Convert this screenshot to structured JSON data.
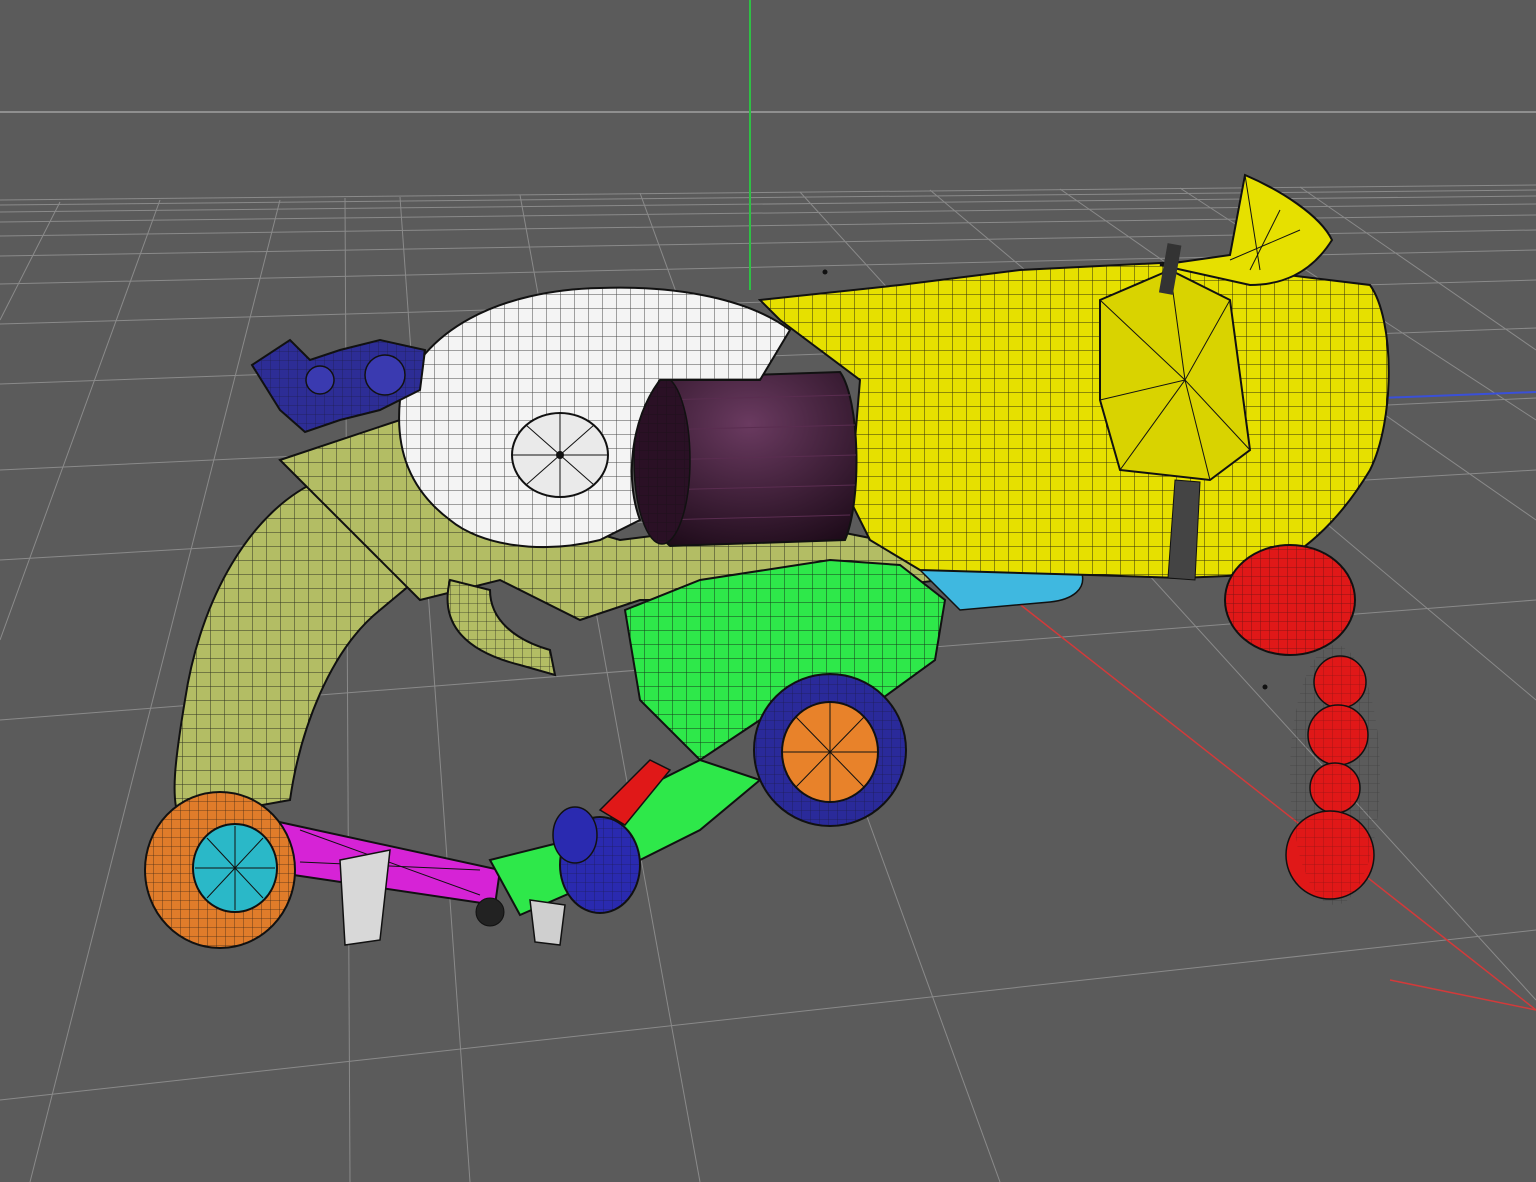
{
  "viewport": {
    "background": "#5b5b5b",
    "grid_color": "#8a8a8a",
    "axis_y_color": "#2fbf45",
    "axis_x_color": "#d23a3a",
    "axis_z_color": "#3a50d8"
  },
  "model": {
    "parts": [
      {
        "id": "barrel",
        "color": "#e6e000"
      },
      {
        "id": "barrel-plate",
        "color": "#d9d300"
      },
      {
        "id": "barrel-fin",
        "color": "#e6e000"
      },
      {
        "id": "hammer-housing",
        "color": "#f4f4f4"
      },
      {
        "id": "cylinder",
        "color": "#3b1535"
      },
      {
        "id": "frame",
        "color": "#b3bd64"
      },
      {
        "id": "grip",
        "color": "#b3bd64"
      },
      {
        "id": "trigger",
        "color": "#b3bd64"
      },
      {
        "id": "magazine",
        "color": "#2ee84a"
      },
      {
        "id": "small-wheel",
        "color": "#e8822a"
      },
      {
        "id": "wheel-tire",
        "color": "#2a2a9a"
      },
      {
        "id": "rear-gear",
        "color": "#2d2d96"
      },
      {
        "id": "underbarrel-tube",
        "color": "#3fb8e0"
      },
      {
        "id": "hanging-beads",
        "color": "#e01818"
      },
      {
        "id": "link-rod",
        "color": "#d623d6"
      },
      {
        "id": "pommel-ring",
        "color": "#e07c2a"
      },
      {
        "id": "pommel-cap",
        "color": "#2ab8c8"
      },
      {
        "id": "joint-roller",
        "color": "#2a2ab0"
      }
    ]
  }
}
